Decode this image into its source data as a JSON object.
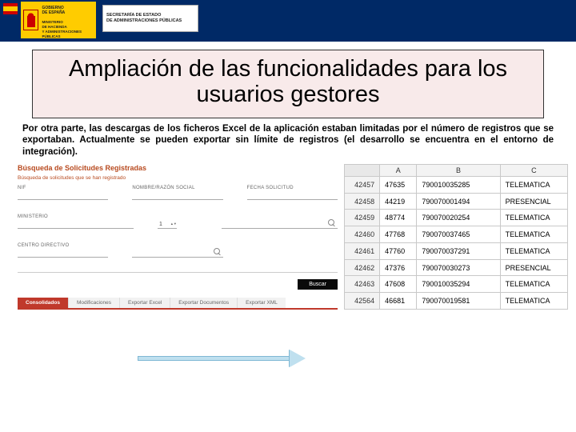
{
  "header": {
    "ministry_lines": "GOBIERNO\nDE ESPAÑA",
    "ministry_lines2": "MINISTERIO\nDE HACIENDA\nY ADMINISTRACIONES PÚBLICAS",
    "secretary_lines": "SECRETARÍA DE ESTADO\nDE ADMINISTRACIONES PÚBLICAS"
  },
  "title": "Ampliación de las funcionalidades para los usuarios gestores",
  "paragraph": "Por otra parte, las descargas de los ficheros Excel de la aplicación estaban limitadas por el número de registros que se exportaban. Actualmente se pueden exportar sin límite de registros (el desarrollo se encuentra en el entorno de integración).",
  "app": {
    "title": "Búsqueda de Solicitudes Registradas",
    "subtitle": "Búsqueda de solicitudes que se han registrado",
    "fields": {
      "nif": "NIF",
      "nombre": "NOMBRE/RAZÓN SOCIAL",
      "fecha_sol": "FECHA SOLICITUD",
      "ministerio": "MINISTERIO",
      "censo": "CENTRO DIRECTIVO"
    },
    "stepper_value": "1",
    "buscar": "Buscar",
    "tabs": [
      "Consolidados",
      "Modificaciones",
      "Exportar Excel",
      "Exportar Documentos",
      "Exportar XML"
    ]
  },
  "spreadsheet": {
    "cols": [
      "",
      "A",
      "B",
      "C"
    ],
    "rows": [
      {
        "n": "42457",
        "a": "47635",
        "b": "790010035285",
        "c": "TELEMATICA"
      },
      {
        "n": "42458",
        "a": "44219",
        "b": "790070001494",
        "c": "PRESENCIAL"
      },
      {
        "n": "42459",
        "a": "48774",
        "b": "790070020254",
        "c": "TELEMATICA"
      },
      {
        "n": "42460",
        "a": "47768",
        "b": "790070037465",
        "c": "TELEMATICA"
      },
      {
        "n": "42461",
        "a": "47760",
        "b": "790070037291",
        "c": "TELEMATICA"
      },
      {
        "n": "42462",
        "a": "47376",
        "b": "790070030273",
        "c": "PRESENCIAL"
      },
      {
        "n": "42463",
        "a": "47608",
        "b": "790010035294",
        "c": "TELEMATICA"
      },
      {
        "n": "42564",
        "a": "46681",
        "b": "790070019581",
        "c": "TELEMATICA"
      }
    ]
  }
}
